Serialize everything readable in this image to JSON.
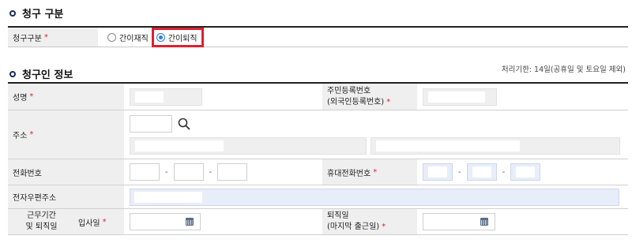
{
  "section1": {
    "title": "청구 구분"
  },
  "claim_type": {
    "label": "청구구분",
    "required": "*",
    "options": [
      "간이재직",
      "간이퇴직"
    ],
    "selected": "간이퇴직"
  },
  "section2": {
    "title": "청구인 정보",
    "deadline": "처리기한: 14일(공휴일 및 토요일 제외)"
  },
  "fields": {
    "name": "성명",
    "rrn": "주민등록번호",
    "rrn_sub": "(외국인등록번호)",
    "address": "주소",
    "phone": "전화번호",
    "mobile": "휴대전화번호",
    "email": "전자우편주소",
    "work_period": "근무기간",
    "work_period2": "및 퇴직일",
    "hire_date": "입사일",
    "retire": "퇴직일",
    "retire_sub": "(마지막 출근일)",
    "required": "*",
    "phone_separator": "-"
  },
  "colors": {
    "required": "#e0202e",
    "radio_active": "#2a7de1",
    "highlight": "#e0202e",
    "email_bg": "#e8eef9"
  },
  "icons": {
    "address_search": "search-icon",
    "date": "calendar-icon"
  }
}
